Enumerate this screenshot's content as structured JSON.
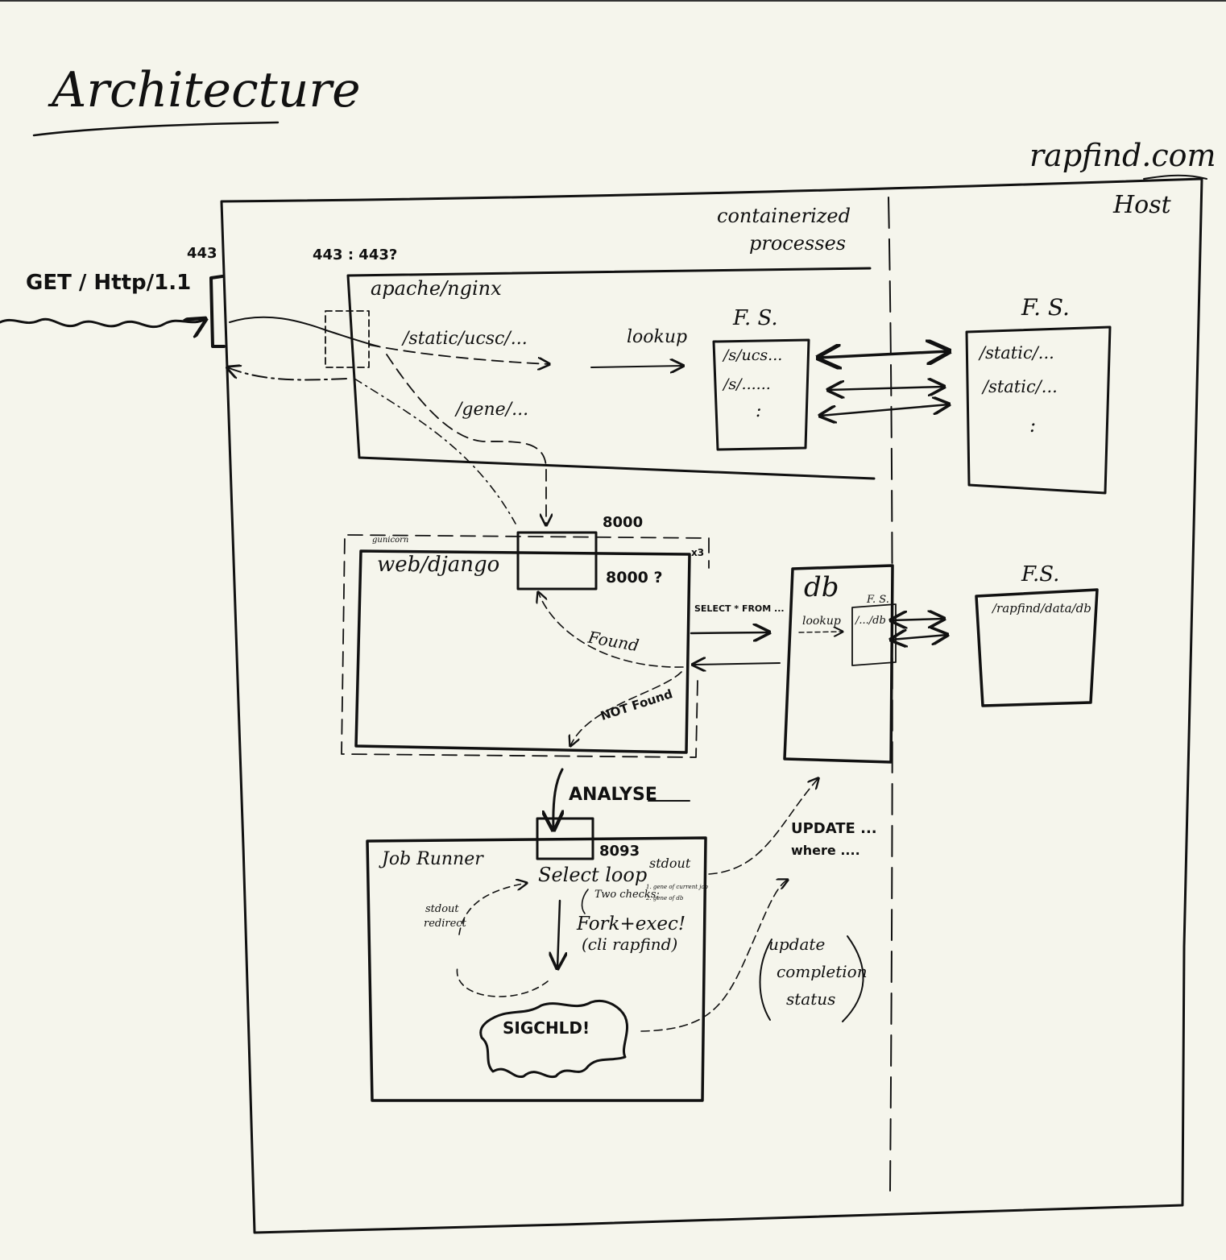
{
  "title": "Architecture",
  "site": "rapfind.com",
  "host_label": "Host",
  "container_label": [
    "containerized",
    "processes"
  ],
  "client": {
    "request": "GET / Http/1.1",
    "port": "443"
  },
  "proxy": {
    "name": "apache/nginx",
    "port_map": "443 : 443?",
    "route_static": "/static/ucsc/...",
    "route_gene": "/gene/...",
    "lookup": "lookup"
  },
  "container_fs": {
    "label": "F. S.",
    "entries": [
      "/s/ucs...",
      "/s/......",
      ":"
    ]
  },
  "host_fs_static": {
    "label": "F. S.",
    "entries": [
      "/static/...",
      "/static/...",
      ":"
    ]
  },
  "web": {
    "name": "web/django",
    "wrapper": "gunicorn",
    "replicas": "x3",
    "port": "8000",
    "port_inner": "8000 ?",
    "query": "SELECT * FROM ...",
    "found": "Found",
    "not_found": "NOT Found"
  },
  "db": {
    "name": "db",
    "fs_label": "F. S.",
    "lookup": "lookup",
    "path": "/.../db"
  },
  "host_fs_db": {
    "label": "F.S.",
    "path": "/rapfind/data/db"
  },
  "analyse": "ANALYSE",
  "job_runner": {
    "name": "Job Runner",
    "port": "8093",
    "select_loop": "Select loop",
    "stdout": "stdout",
    "two_checks": "Two checks:",
    "check_1": "1. gene of current job",
    "check_2": "2. gene of db",
    "fork_exec": "Fork+exec!",
    "cli": "(cli rapfind)",
    "redirect": [
      "stdout",
      "redirect"
    ],
    "sigchld": "SIGCHLD!"
  },
  "update_query": [
    "UPDATE ...",
    "where ...."
  ],
  "update_status": [
    "update",
    "completion",
    "status"
  ]
}
